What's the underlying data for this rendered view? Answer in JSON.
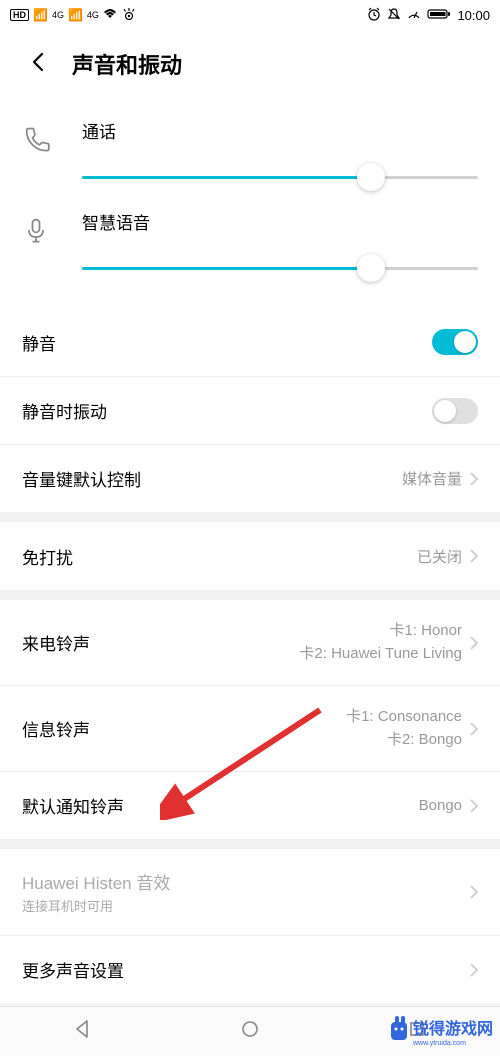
{
  "status": {
    "hd": "HD",
    "sim1_icon": "1",
    "signal_4g": "4G",
    "time": "10:00"
  },
  "header": {
    "title": "声音和振动"
  },
  "volumes": {
    "call": {
      "label": "通话",
      "percent": 73
    },
    "voice": {
      "label": "智慧语音",
      "percent": 73
    }
  },
  "toggles": {
    "silent": {
      "label": "静音",
      "on": true
    },
    "vibrate_on_silent": {
      "label": "静音时振动",
      "on": false
    }
  },
  "items": {
    "volume_key": {
      "label": "音量键默认控制",
      "value": "媒体音量"
    },
    "dnd": {
      "label": "免打扰",
      "value": "已关闭"
    },
    "incoming_ring": {
      "label": "来电铃声",
      "line1": "卡1: Honor",
      "line2": "卡2: Huawei Tune Living"
    },
    "message_ring": {
      "label": "信息铃声",
      "line1": "卡1: Consonance",
      "line2": "卡2: Bongo"
    },
    "default_notif": {
      "label": "默认通知铃声",
      "value": "Bongo"
    },
    "histen": {
      "label": "Huawei Histen 音效",
      "sub": "连接耳机时可用"
    },
    "more": {
      "label": "更多声音设置"
    }
  },
  "watermark": {
    "text": "锐得游戏网",
    "url": "www.ytruida.com"
  }
}
